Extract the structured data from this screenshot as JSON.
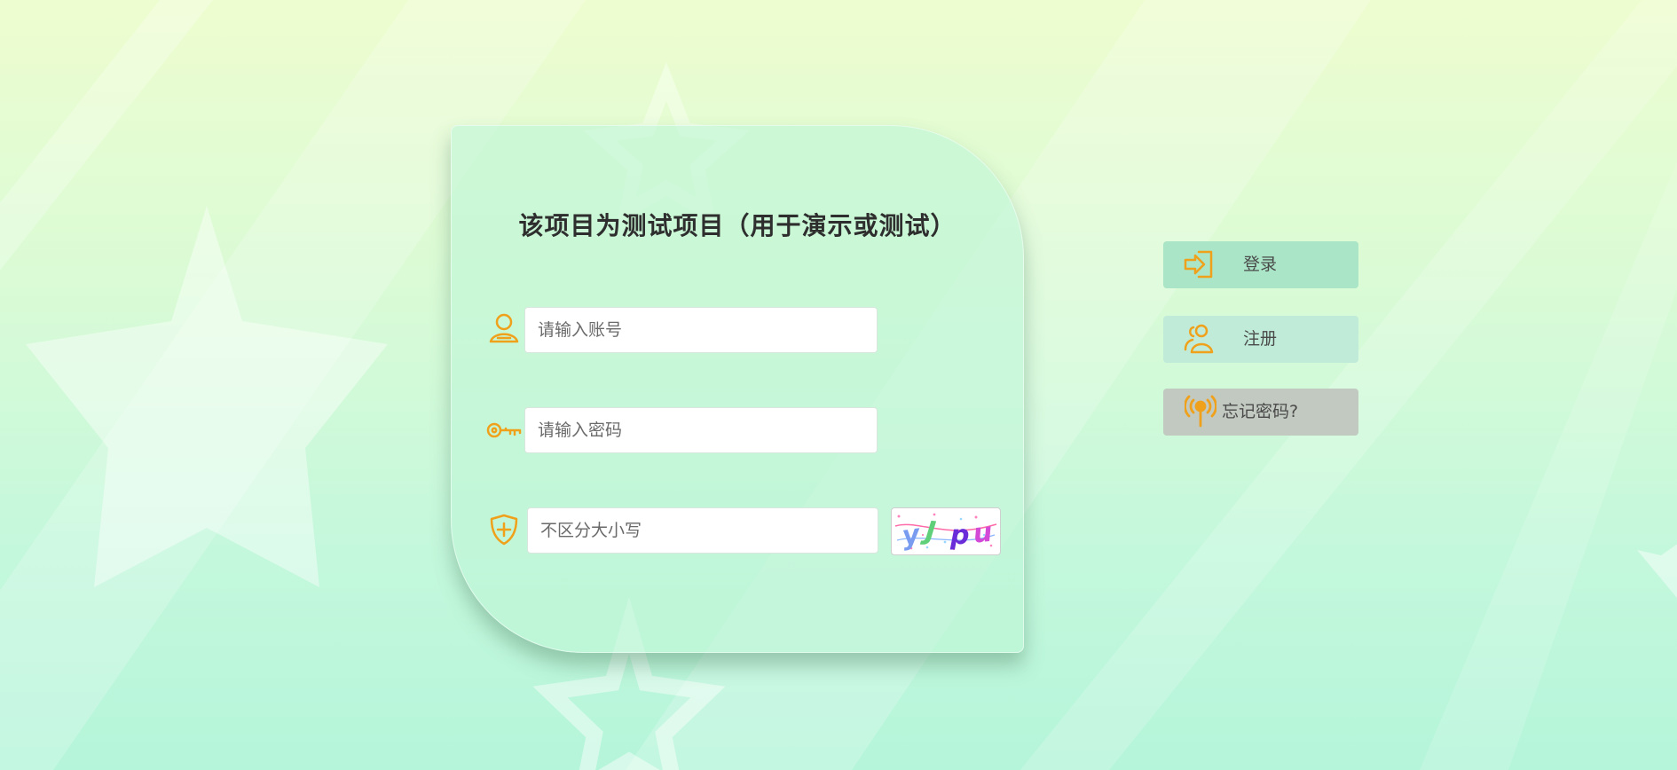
{
  "login_form": {
    "title": "该项目为测试项目（用于演示或测试）",
    "username": {
      "value": "",
      "placeholder": "请输入账号"
    },
    "password": {
      "value": "",
      "placeholder": "请输入密码"
    },
    "captcha": {
      "value": "",
      "placeholder": "不区分大小写",
      "image_text": "yJpu"
    }
  },
  "side_menu": {
    "login_label": "登录",
    "register_label": "注册",
    "forgot_label": "忘记密码?"
  },
  "icons": {
    "username": "user-icon",
    "password": "key-icon",
    "captcha": "shield-plus-icon",
    "login": "sign-in-icon",
    "register": "users-icon",
    "forgot": "pin-signal-icon"
  },
  "colors": {
    "icon_accent": "#f0a11b",
    "title_text": "#2e2e2e",
    "login_button_bg": "#a9e5c6",
    "register_button_bg": "#c0ebd8",
    "forgot_button_bg": "#c1c9c0"
  }
}
